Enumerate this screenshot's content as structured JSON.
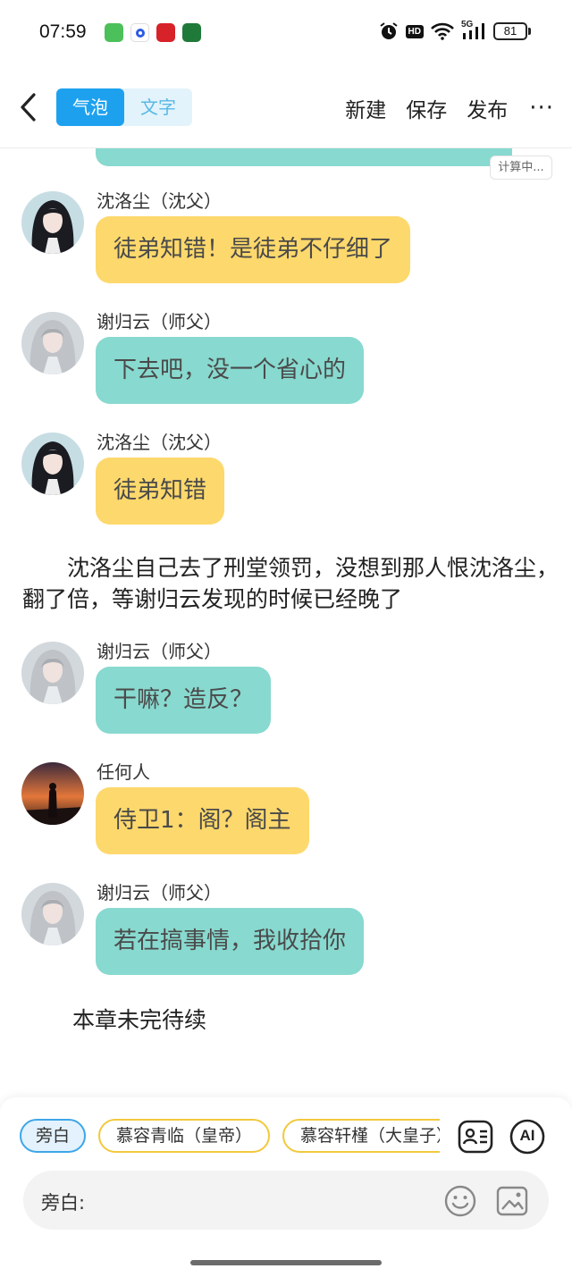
{
  "status_bar": {
    "time": "07:59",
    "network": "5G",
    "battery": "81",
    "hd": "HD"
  },
  "header": {
    "tabs": [
      {
        "label": "气泡",
        "active": true
      },
      {
        "label": "文字",
        "active": false
      }
    ],
    "new_label": "新建",
    "save_label": "保存",
    "publish_label": "发布",
    "more_label": "···"
  },
  "chat": {
    "calculating_badge": "计算中...",
    "messages": [
      {
        "speaker": "沈洛尘（沈父）",
        "text": "徒弟知错！是徒弟不仔细了",
        "color": "#fdd86c",
        "avatar": "dark-hair-man-avatar"
      },
      {
        "speaker": "谢归云（师父）",
        "text": "下去吧，没一个省心的",
        "color": "#88d9cf",
        "avatar": "white-hair-man-avatar"
      },
      {
        "speaker": "沈洛尘（沈父）",
        "text": "徒弟知错",
        "color": "#fdd86c",
        "avatar": "dark-hair-man-avatar"
      },
      {
        "speaker": "谢归云（师父）",
        "text": "干嘛？造反？",
        "color": "#88d9cf",
        "avatar": "white-hair-man-avatar"
      },
      {
        "speaker": "任何人",
        "text": "侍卫1：阁？阁主",
        "color": "#fdd86c",
        "avatar": "sunset-silhouette-avatar"
      },
      {
        "speaker": "谢归云（师父）",
        "text": "若在搞事情，我收拾你",
        "color": "#88d9cf",
        "avatar": "white-hair-man-avatar"
      }
    ],
    "narration": "　　沈洛尘自己去了刑堂领罚，没想到那人恨沈洛尘，翻了倍，等谢归云发现的时候已经晚了",
    "end_text": "本章未完待续"
  },
  "bottom": {
    "chips": [
      {
        "label": "旁白",
        "type": "narrator"
      },
      {
        "label": "慕容青临（皇帝）",
        "type": "role"
      },
      {
        "label": "慕容轩槿（大皇子）",
        "type": "role"
      }
    ],
    "ai_label": "AI",
    "input_label": "旁白:",
    "input_value": ""
  },
  "colors": {
    "accent": "#1da1ef",
    "bubble_yellow": "#fdd86c",
    "bubble_teal": "#88d9cf",
    "chip_yellow_border": "#f2c93d"
  }
}
